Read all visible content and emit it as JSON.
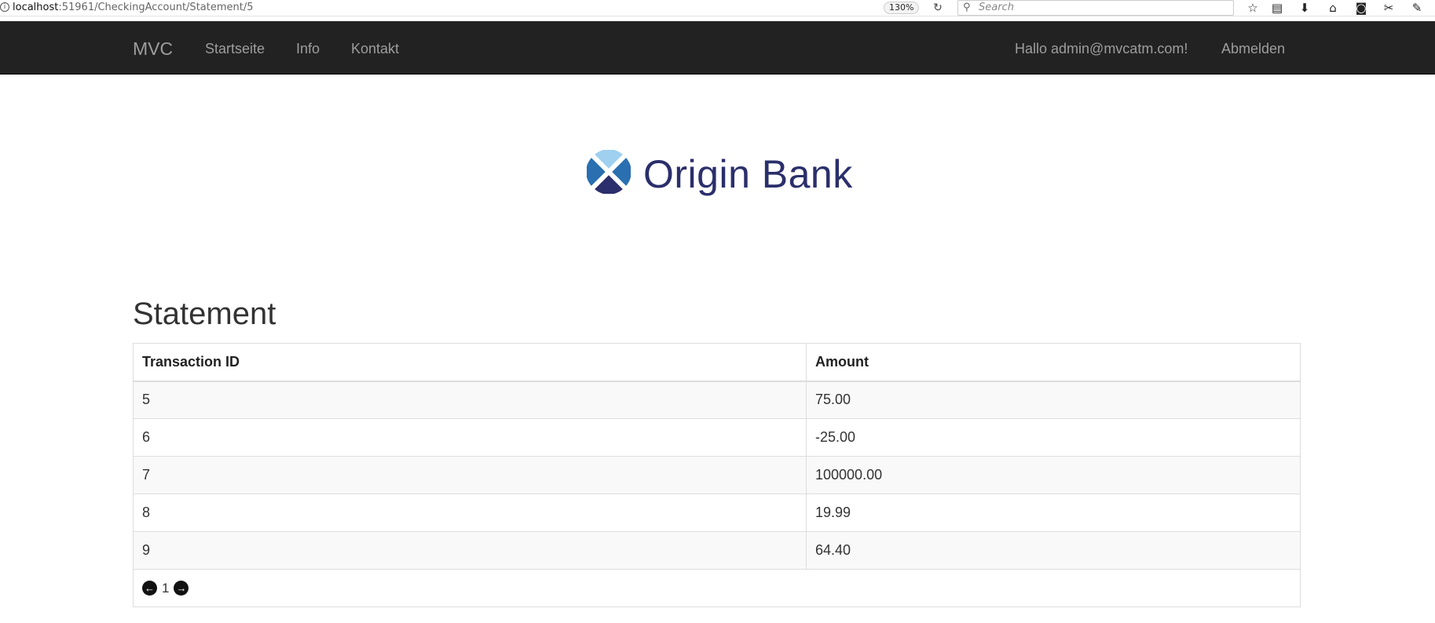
{
  "browser": {
    "url_host": "localhost",
    "url_path": ":51961/CheckingAccount/Statement/5",
    "zoom": "130%",
    "search_placeholder": "Search"
  },
  "navbar": {
    "brand": "MVC",
    "links": [
      "Startseite",
      "Info",
      "Kontakt"
    ],
    "greeting": "Hallo admin@mvcatm.com!",
    "logout": "Abmelden"
  },
  "logo": {
    "text": "Origin Bank"
  },
  "page": {
    "title": "Statement"
  },
  "table": {
    "headers": [
      "Transaction ID",
      "Amount"
    ],
    "rows": [
      [
        "5",
        "75.00"
      ],
      [
        "6",
        "-25.00"
      ],
      [
        "7",
        "100000.00"
      ],
      [
        "8",
        "19.99"
      ],
      [
        "9",
        "64.40"
      ]
    ]
  },
  "pager": {
    "current_page": "1"
  },
  "colors": {
    "navbar_bg": "#222222",
    "nav_text": "#9d9d9d",
    "logo_text": "#2b2f6b",
    "logo_blue": "#2a6fb0",
    "logo_light": "#9fd0ef"
  }
}
